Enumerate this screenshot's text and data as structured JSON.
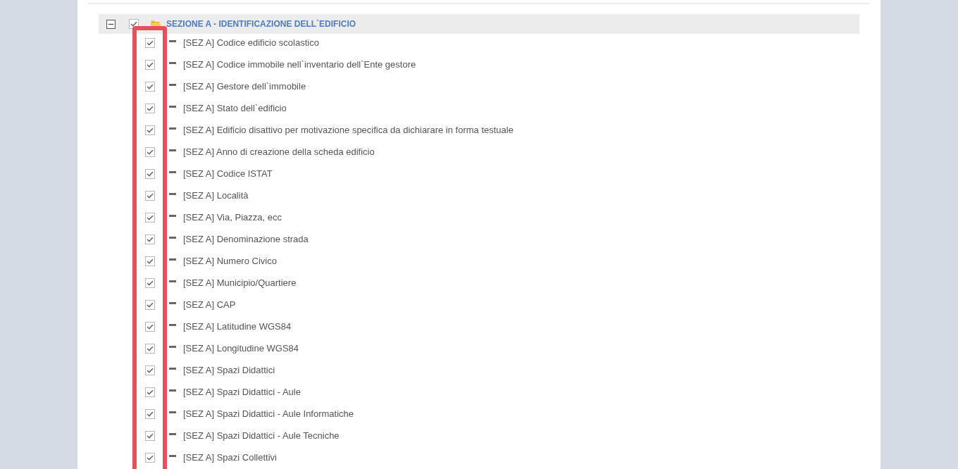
{
  "section": {
    "title": "SEZIONE A - IDENTIFICAZIONE DELL`EDIFICIO",
    "expanded": true,
    "checked": true,
    "items": [
      {
        "label": "[SEZ A] Codice edificio scolastico",
        "checked": true
      },
      {
        "label": "[SEZ A] Codice immobile nell`inventario dell`Ente gestore",
        "checked": true
      },
      {
        "label": "[SEZ A] Gestore dell`immobile",
        "checked": true
      },
      {
        "label": "[SEZ A] Stato dell`edificio",
        "checked": true
      },
      {
        "label": "[SEZ A] Edificio disattivo per motivazione specifica da dichiarare in forma testuale",
        "checked": true
      },
      {
        "label": "[SEZ A] Anno di creazione della scheda edificio",
        "checked": true
      },
      {
        "label": "[SEZ A] Codice ISTAT",
        "checked": true
      },
      {
        "label": "[SEZ A] Località",
        "checked": true
      },
      {
        "label": "[SEZ A] Via, Piazza, ecc",
        "checked": true
      },
      {
        "label": "[SEZ A] Denominazione strada",
        "checked": true
      },
      {
        "label": "[SEZ A] Numero Civico",
        "checked": true
      },
      {
        "label": "[SEZ A] Municipio/Quartiere",
        "checked": true
      },
      {
        "label": "[SEZ A] CAP",
        "checked": true
      },
      {
        "label": "[SEZ A] Latitudine WGS84",
        "checked": true
      },
      {
        "label": "[SEZ A] Longitudine WGS84",
        "checked": true
      },
      {
        "label": "[SEZ A] Spazi Didattici",
        "checked": true
      },
      {
        "label": "[SEZ A] Spazi Didattici - Aule",
        "checked": true
      },
      {
        "label": "[SEZ A] Spazi Didattici - Aule Informatiche",
        "checked": true
      },
      {
        "label": "[SEZ A] Spazi Didattici - Aule Tecniche",
        "checked": true
      },
      {
        "label": "[SEZ A] Spazi Collettivi",
        "checked": true
      }
    ]
  }
}
